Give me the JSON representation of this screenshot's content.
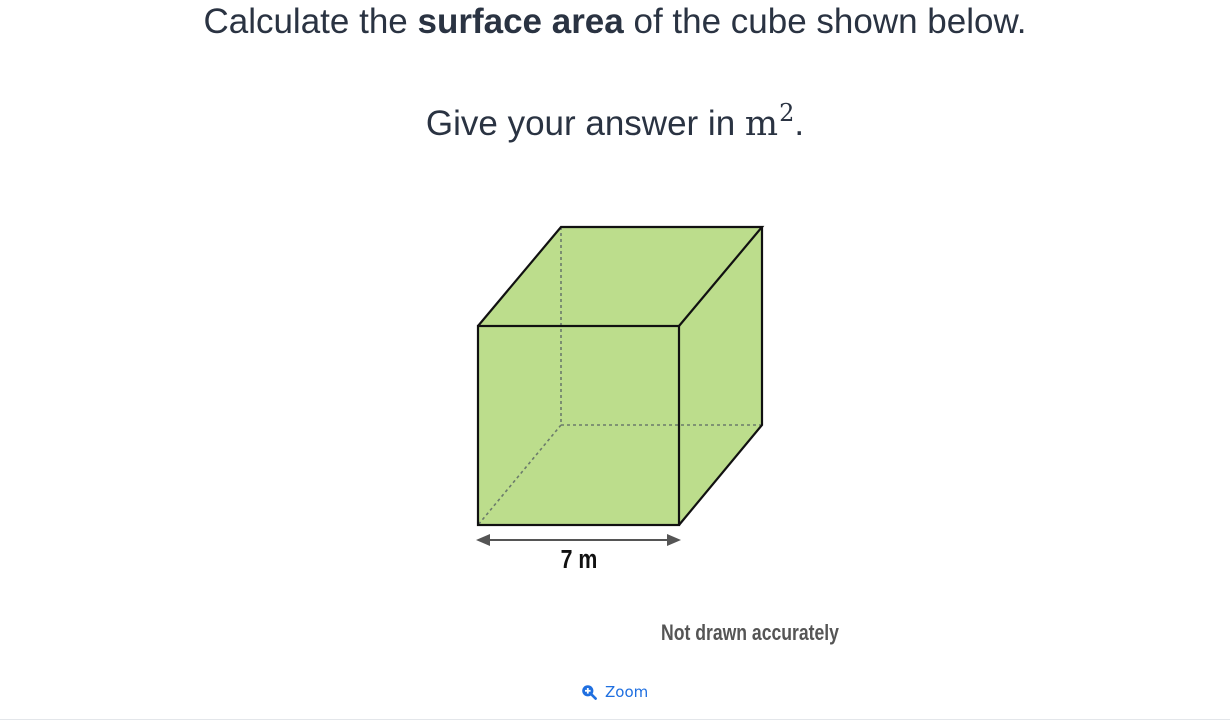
{
  "question": {
    "line1_prefix": "Calculate the ",
    "line1_bold": "surface area",
    "line1_suffix": " of the cube shown below.",
    "line2_prefix": "Give your answer in ",
    "unit_base": "m",
    "unit_exponent": "2",
    "line2_suffix": "."
  },
  "diagram": {
    "shape": "cube",
    "dimension_label": "7 m",
    "note": "Not drawn accurately",
    "face_color": "#bcdd8c",
    "edge_color": "#111111",
    "hidden_edge_color": "#6b7b6b",
    "arrow_color": "#555555"
  },
  "controls": {
    "zoom_label": "Zoom",
    "zoom_icon": "zoom-in-icon",
    "accent": "#1f6fe0"
  }
}
